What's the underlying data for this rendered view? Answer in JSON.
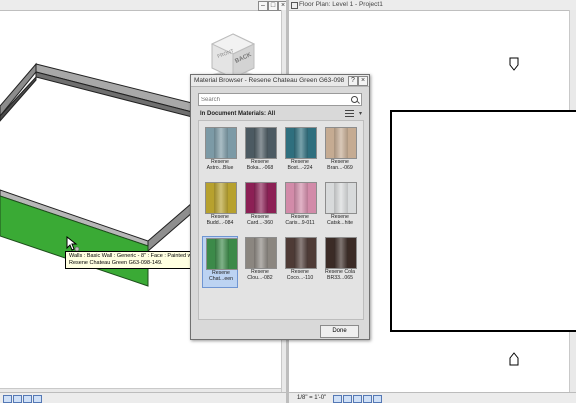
{
  "left_view": {
    "tooltip": "Walls : Basic Wall : Generic - 8\" : Face : Painted with Resene Chateau Green G63-098-149.",
    "viewcube_face": "BACK",
    "wall_paint_color": "#3aaa35"
  },
  "right_view": {
    "title": "Floor Plan: Level 1 - Project1",
    "scale": "1/8\" = 1'-0\""
  },
  "material_browser": {
    "title": "Material Browser - Resene Chateau Green G63-098-149",
    "search_placeholder": "Search",
    "section_label": "In Document Materials: All",
    "done_label": "Done",
    "materials": [
      {
        "label": "Resene\nAstro...Blue",
        "color": "#7c9aa6"
      },
      {
        "label": "Resene\nBoka...-068",
        "color": "#4c5a62"
      },
      {
        "label": "Resene\nBost...-224",
        "color": "#2f6f7e"
      },
      {
        "label": "Resene\nBran...-069",
        "color": "#c5ab92"
      },
      {
        "label": "Resene\nBudd...-084",
        "color": "#b7a12e"
      },
      {
        "label": "Resene\nCard...-360",
        "color": "#8c2055"
      },
      {
        "label": "Resene\nCaris...9-011",
        "color": "#d28ba9"
      },
      {
        "label": "Resene\nCatsk...hite",
        "color": "#d8dadb"
      },
      {
        "label": "Resene\nChat...een",
        "color": "#3c8a49",
        "selected": true
      },
      {
        "label": "Resene\nClou...-082",
        "color": "#8b8680"
      },
      {
        "label": "Resene\nCoco...-110",
        "color": "#4e3b36"
      },
      {
        "label": "Resene Cola\nBR33...065",
        "color": "#3b2b26"
      }
    ]
  }
}
